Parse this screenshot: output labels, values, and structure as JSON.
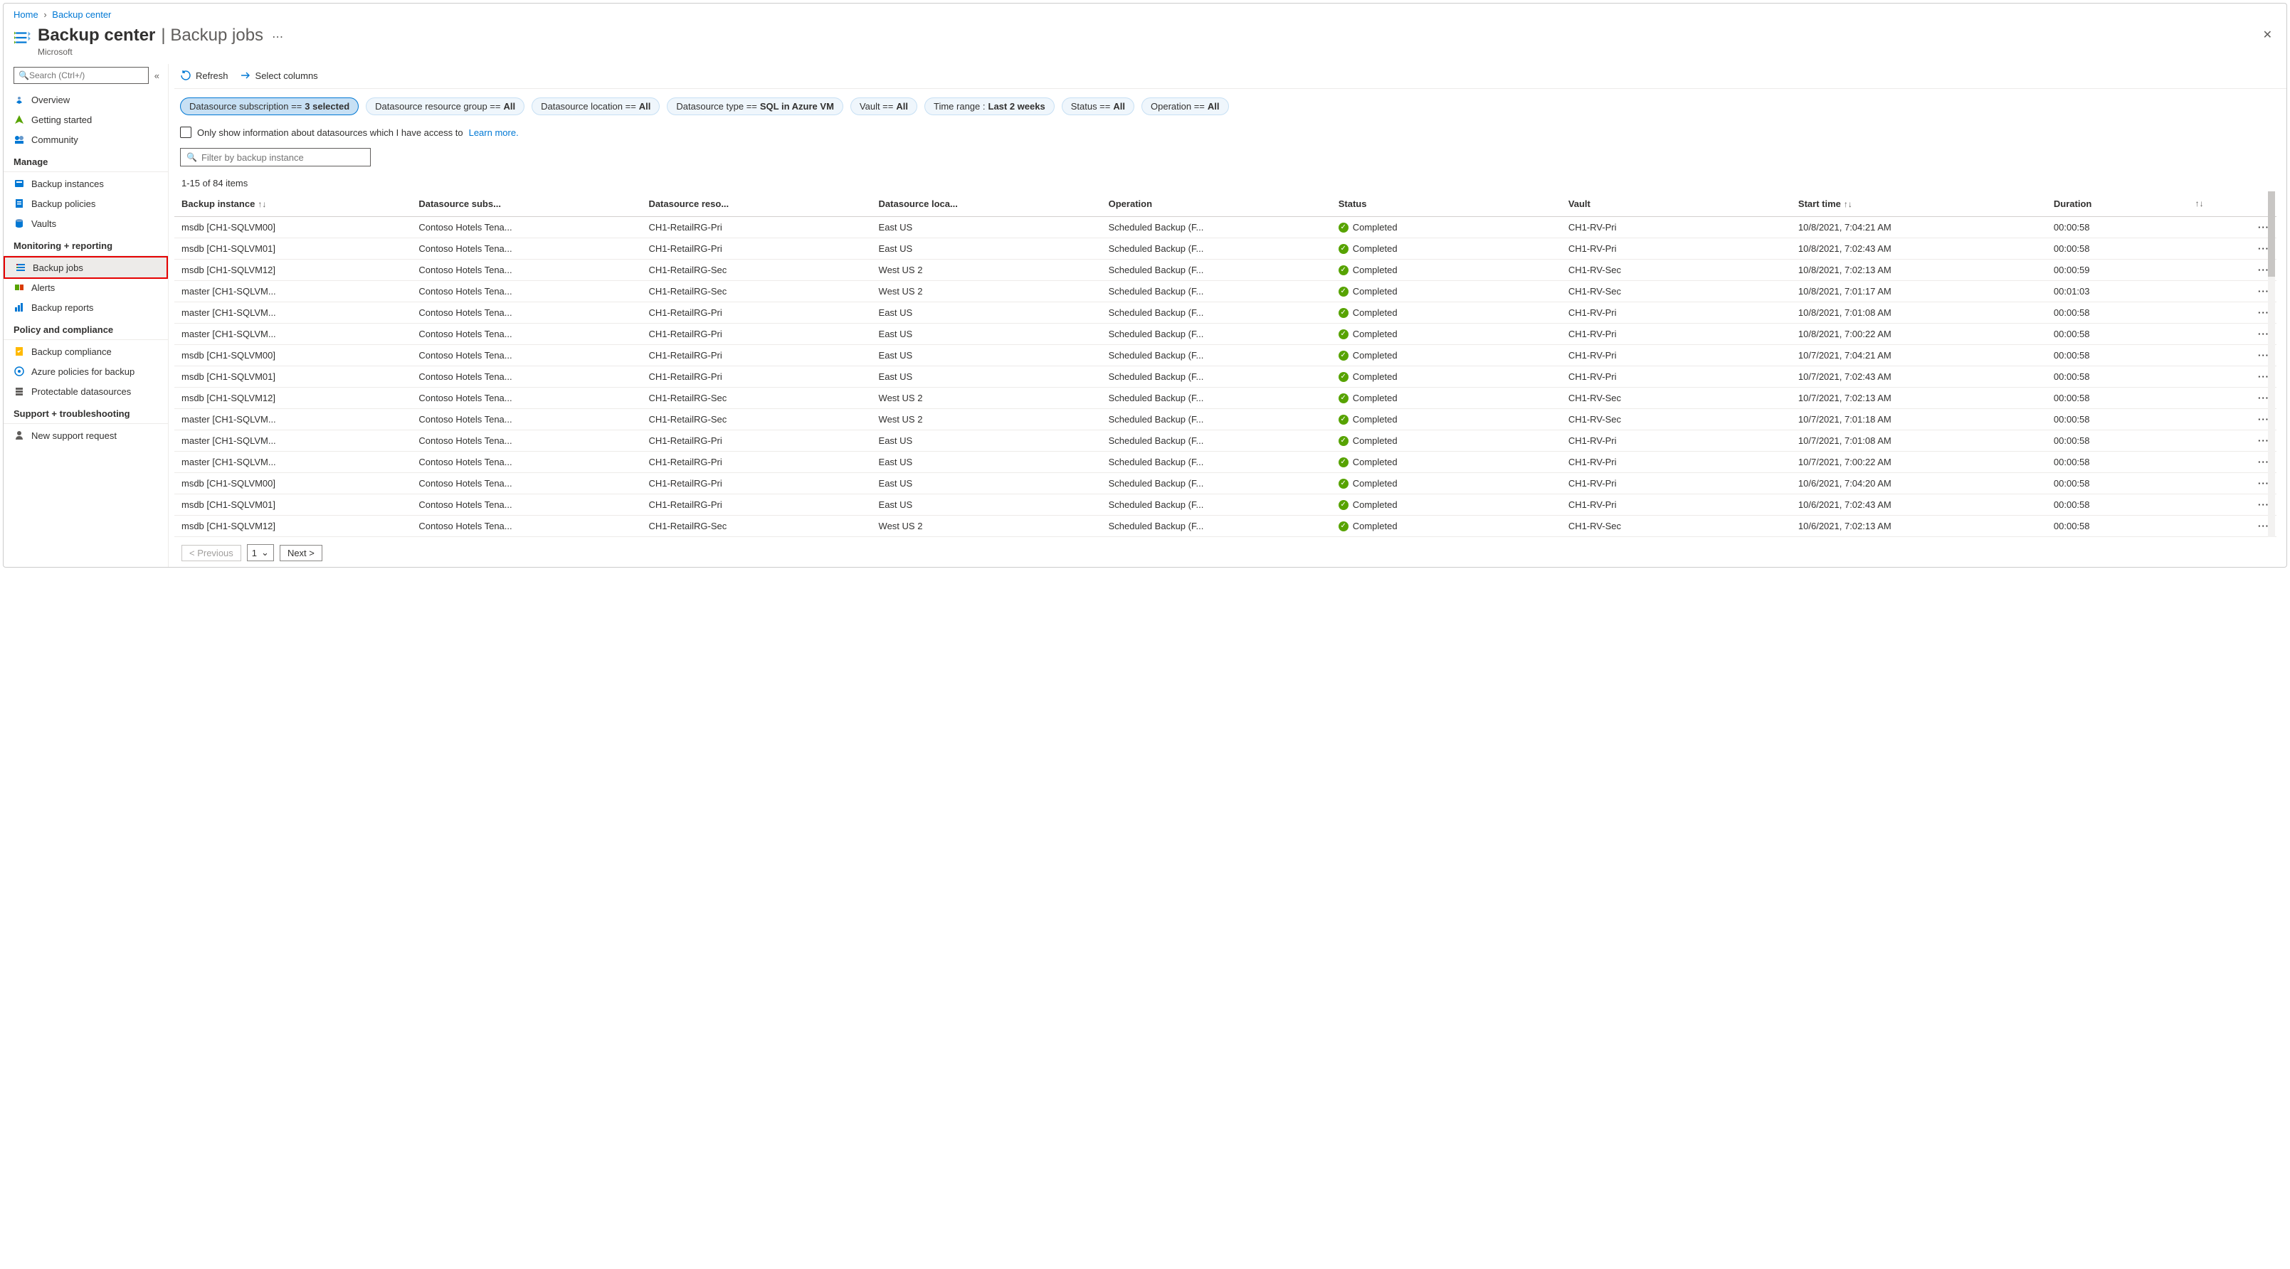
{
  "breadcrumb": {
    "home": "Home",
    "current": "Backup center"
  },
  "header": {
    "title": "Backup center",
    "subtitle": "Backup jobs",
    "tenant": "Microsoft"
  },
  "search": {
    "placeholder": "Search (Ctrl+/)"
  },
  "nav": {
    "top": [
      {
        "label": "Overview"
      },
      {
        "label": "Getting started"
      },
      {
        "label": "Community"
      }
    ],
    "groups": [
      {
        "title": "Manage",
        "items": [
          {
            "label": "Backup instances"
          },
          {
            "label": "Backup policies"
          },
          {
            "label": "Vaults"
          }
        ]
      },
      {
        "title": "Monitoring + reporting",
        "items": [
          {
            "label": "Backup jobs",
            "selected": true
          },
          {
            "label": "Alerts"
          },
          {
            "label": "Backup reports"
          }
        ]
      },
      {
        "title": "Policy and compliance",
        "items": [
          {
            "label": "Backup compliance"
          },
          {
            "label": "Azure policies for backup"
          },
          {
            "label": "Protectable datasources"
          }
        ]
      },
      {
        "title": "Support + troubleshooting",
        "items": [
          {
            "label": "New support request"
          }
        ]
      }
    ]
  },
  "toolbar": {
    "refresh": "Refresh",
    "select_columns": "Select columns"
  },
  "filters": [
    {
      "label": "Datasource subscription == ",
      "value": "3 selected",
      "active": true
    },
    {
      "label": "Datasource resource group == ",
      "value": "All"
    },
    {
      "label": "Datasource location == ",
      "value": "All"
    },
    {
      "label": "Datasource type == ",
      "value": "SQL in Azure VM"
    },
    {
      "label": "Vault == ",
      "value": "All"
    },
    {
      "label": "Time range : ",
      "value": "Last 2 weeks"
    },
    {
      "label": "Status == ",
      "value": "All"
    },
    {
      "label": "Operation == ",
      "value": "All"
    }
  ],
  "access_row": {
    "text": "Only show information about datasources which I have access to ",
    "link": "Learn more."
  },
  "filter_input": {
    "placeholder": "Filter by backup instance"
  },
  "count_text": "1-15 of 84 items",
  "columns": {
    "instance": "Backup instance",
    "subs": "Datasource subs...",
    "rg": "Datasource reso...",
    "loc": "Datasource loca...",
    "op": "Operation",
    "status": "Status",
    "vault": "Vault",
    "start": "Start time",
    "duration": "Duration"
  },
  "rows": [
    {
      "instance": "msdb [CH1-SQLVM00]",
      "subs": "Contoso Hotels Tena...",
      "rg": "CH1-RetailRG-Pri",
      "loc": "East US",
      "op": "Scheduled Backup (F...",
      "status": "Completed",
      "vault": "CH1-RV-Pri",
      "start": "10/8/2021, 7:04:21 AM",
      "duration": "00:00:58"
    },
    {
      "instance": "msdb [CH1-SQLVM01]",
      "subs": "Contoso Hotels Tena...",
      "rg": "CH1-RetailRG-Pri",
      "loc": "East US",
      "op": "Scheduled Backup (F...",
      "status": "Completed",
      "vault": "CH1-RV-Pri",
      "start": "10/8/2021, 7:02:43 AM",
      "duration": "00:00:58"
    },
    {
      "instance": "msdb [CH1-SQLVM12]",
      "subs": "Contoso Hotels Tena...",
      "rg": "CH1-RetailRG-Sec",
      "loc": "West US 2",
      "op": "Scheduled Backup (F...",
      "status": "Completed",
      "vault": "CH1-RV-Sec",
      "start": "10/8/2021, 7:02:13 AM",
      "duration": "00:00:59"
    },
    {
      "instance": "master [CH1-SQLVM...",
      "subs": "Contoso Hotels Tena...",
      "rg": "CH1-RetailRG-Sec",
      "loc": "West US 2",
      "op": "Scheduled Backup (F...",
      "status": "Completed",
      "vault": "CH1-RV-Sec",
      "start": "10/8/2021, 7:01:17 AM",
      "duration": "00:01:03"
    },
    {
      "instance": "master [CH1-SQLVM...",
      "subs": "Contoso Hotels Tena...",
      "rg": "CH1-RetailRG-Pri",
      "loc": "East US",
      "op": "Scheduled Backup (F...",
      "status": "Completed",
      "vault": "CH1-RV-Pri",
      "start": "10/8/2021, 7:01:08 AM",
      "duration": "00:00:58"
    },
    {
      "instance": "master [CH1-SQLVM...",
      "subs": "Contoso Hotels Tena...",
      "rg": "CH1-RetailRG-Pri",
      "loc": "East US",
      "op": "Scheduled Backup (F...",
      "status": "Completed",
      "vault": "CH1-RV-Pri",
      "start": "10/8/2021, 7:00:22 AM",
      "duration": "00:00:58"
    },
    {
      "instance": "msdb [CH1-SQLVM00]",
      "subs": "Contoso Hotels Tena...",
      "rg": "CH1-RetailRG-Pri",
      "loc": "East US",
      "op": "Scheduled Backup (F...",
      "status": "Completed",
      "vault": "CH1-RV-Pri",
      "start": "10/7/2021, 7:04:21 AM",
      "duration": "00:00:58"
    },
    {
      "instance": "msdb [CH1-SQLVM01]",
      "subs": "Contoso Hotels Tena...",
      "rg": "CH1-RetailRG-Pri",
      "loc": "East US",
      "op": "Scheduled Backup (F...",
      "status": "Completed",
      "vault": "CH1-RV-Pri",
      "start": "10/7/2021, 7:02:43 AM",
      "duration": "00:00:58"
    },
    {
      "instance": "msdb [CH1-SQLVM12]",
      "subs": "Contoso Hotels Tena...",
      "rg": "CH1-RetailRG-Sec",
      "loc": "West US 2",
      "op": "Scheduled Backup (F...",
      "status": "Completed",
      "vault": "CH1-RV-Sec",
      "start": "10/7/2021, 7:02:13 AM",
      "duration": "00:00:58"
    },
    {
      "instance": "master [CH1-SQLVM...",
      "subs": "Contoso Hotels Tena...",
      "rg": "CH1-RetailRG-Sec",
      "loc": "West US 2",
      "op": "Scheduled Backup (F...",
      "status": "Completed",
      "vault": "CH1-RV-Sec",
      "start": "10/7/2021, 7:01:18 AM",
      "duration": "00:00:58"
    },
    {
      "instance": "master [CH1-SQLVM...",
      "subs": "Contoso Hotels Tena...",
      "rg": "CH1-RetailRG-Pri",
      "loc": "East US",
      "op": "Scheduled Backup (F...",
      "status": "Completed",
      "vault": "CH1-RV-Pri",
      "start": "10/7/2021, 7:01:08 AM",
      "duration": "00:00:58"
    },
    {
      "instance": "master [CH1-SQLVM...",
      "subs": "Contoso Hotels Tena...",
      "rg": "CH1-RetailRG-Pri",
      "loc": "East US",
      "op": "Scheduled Backup (F...",
      "status": "Completed",
      "vault": "CH1-RV-Pri",
      "start": "10/7/2021, 7:00:22 AM",
      "duration": "00:00:58"
    },
    {
      "instance": "msdb [CH1-SQLVM00]",
      "subs": "Contoso Hotels Tena...",
      "rg": "CH1-RetailRG-Pri",
      "loc": "East US",
      "op": "Scheduled Backup (F...",
      "status": "Completed",
      "vault": "CH1-RV-Pri",
      "start": "10/6/2021, 7:04:20 AM",
      "duration": "00:00:58"
    },
    {
      "instance": "msdb [CH1-SQLVM01]",
      "subs": "Contoso Hotels Tena...",
      "rg": "CH1-RetailRG-Pri",
      "loc": "East US",
      "op": "Scheduled Backup (F...",
      "status": "Completed",
      "vault": "CH1-RV-Pri",
      "start": "10/6/2021, 7:02:43 AM",
      "duration": "00:00:58"
    },
    {
      "instance": "msdb [CH1-SQLVM12]",
      "subs": "Contoso Hotels Tena...",
      "rg": "CH1-RetailRG-Sec",
      "loc": "West US 2",
      "op": "Scheduled Backup (F...",
      "status": "Completed",
      "vault": "CH1-RV-Sec",
      "start": "10/6/2021, 7:02:13 AM",
      "duration": "00:00:58"
    }
  ],
  "pager": {
    "prev": "< Previous",
    "page": "1",
    "next": "Next >"
  }
}
